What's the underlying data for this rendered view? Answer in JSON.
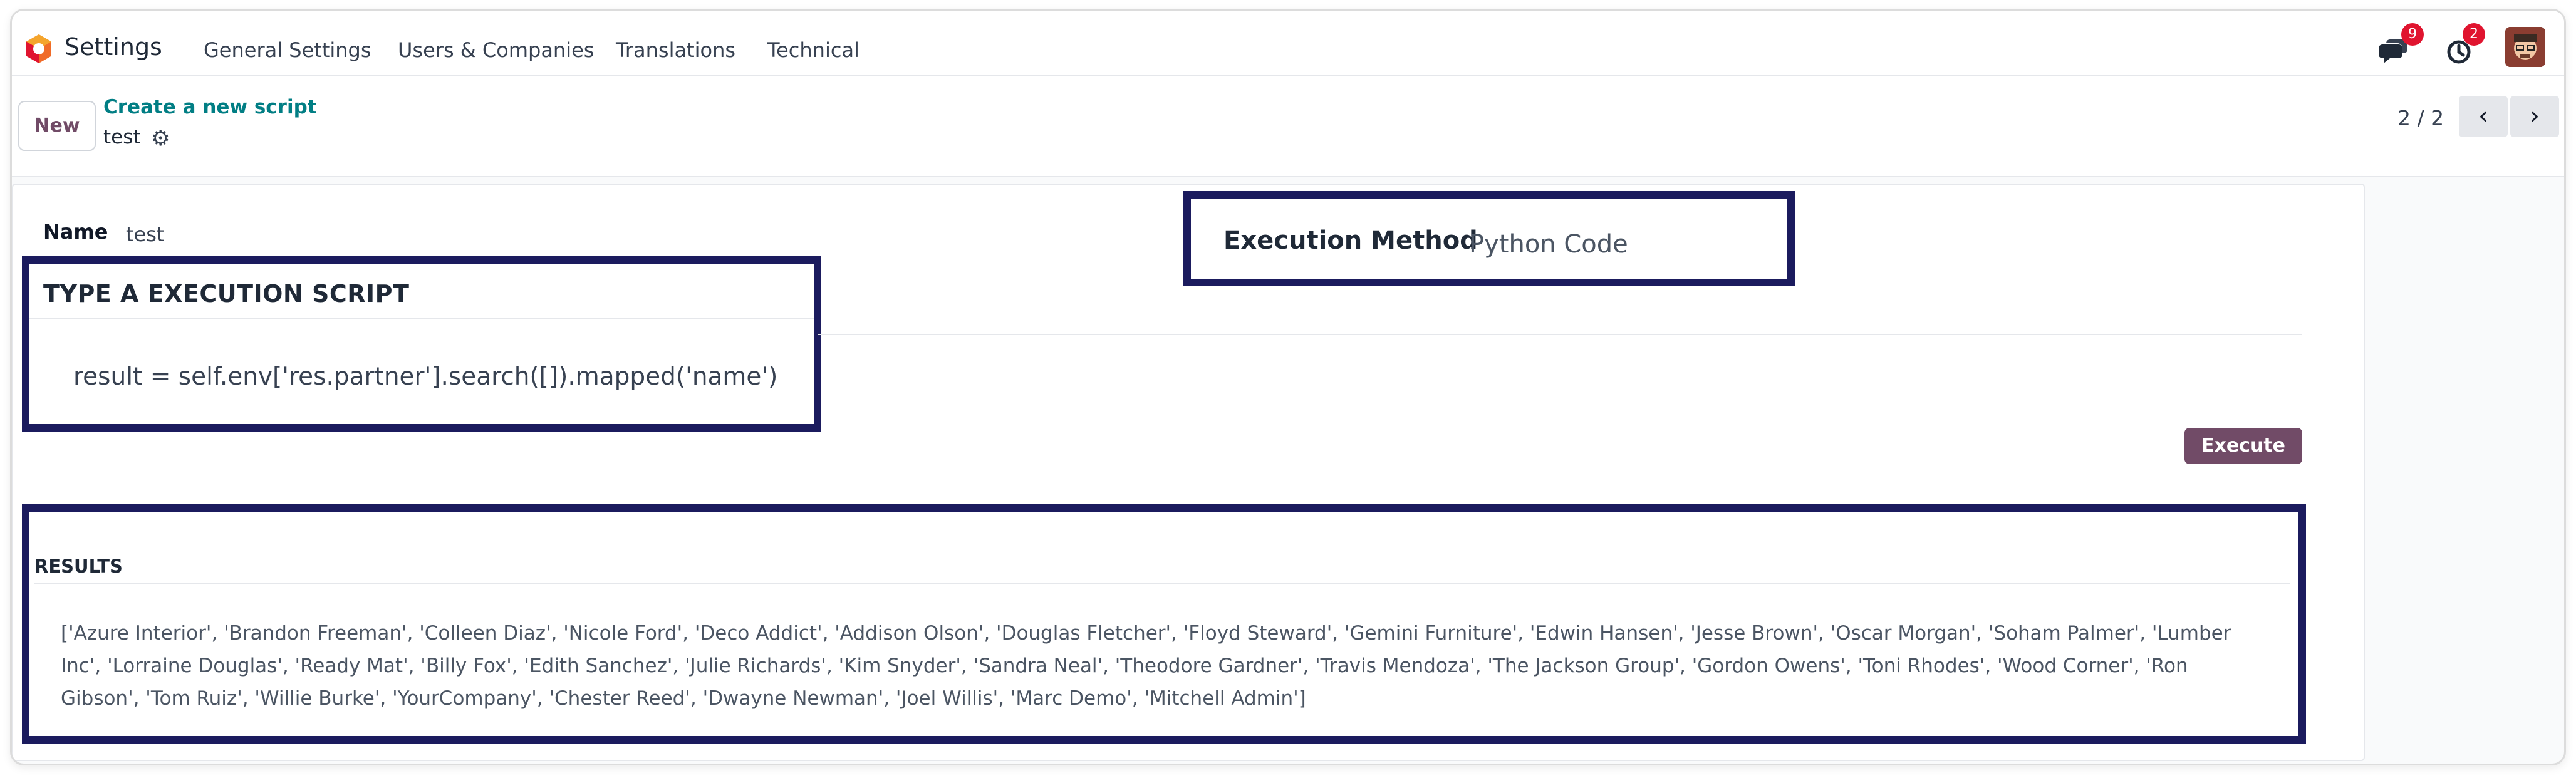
{
  "navbar": {
    "app_name": "Settings",
    "menu": [
      "General Settings",
      "Users & Companies",
      "Translations",
      "Technical"
    ],
    "messages_count": "9",
    "activities_count": "2",
    "icons": [
      "odoo-logo-icon",
      "chat-icon",
      "clock-icon",
      "user-avatar"
    ]
  },
  "control_panel": {
    "new_label": "New",
    "breadcrumb_parent": "Create a new script",
    "breadcrumb_current": "test",
    "pager": "2 / 2"
  },
  "form": {
    "name_label": "Name",
    "name_value": "test",
    "execution_method_label": "Execution Method",
    "execution_method_value": "Python Code",
    "script_section_title": "TYPE A EXECUTION SCRIPT",
    "script_code": "result = self.env['res.partner'].search([]).mapped('name')",
    "execute_label": "Execute",
    "results_title": "RESULTS",
    "results_text": "['Azure Interior', 'Brandon Freeman', 'Colleen Diaz', 'Nicole Ford', 'Deco Addict', 'Addison Olson', 'Douglas Fletcher', 'Floyd Steward', 'Gemini Furniture', 'Edwin Hansen', 'Jesse Brown', 'Oscar Morgan', 'Soham Palmer', 'Lumber Inc', 'Lorraine Douglas', 'Ready Mat', 'Billy Fox', 'Edith Sanchez', 'Julie Richards', 'Kim Snyder', 'Sandra Neal', 'Theodore Gardner', 'Travis Mendoza', 'The Jackson Group', 'Gordon Owens', 'Toni Rhodes', 'Wood Corner', 'Ron Gibson', 'Tom Ruiz', 'Willie Burke', 'YourCompany', 'Chester Reed', 'Dwayne Newman', 'Joel Willis', 'Marc Demo', 'Mitchell Admin']"
  },
  "colors": {
    "brand": "#714b67",
    "link": "#017e84",
    "highlight_border": "#1b1b5e",
    "badge": "#e0142f"
  }
}
